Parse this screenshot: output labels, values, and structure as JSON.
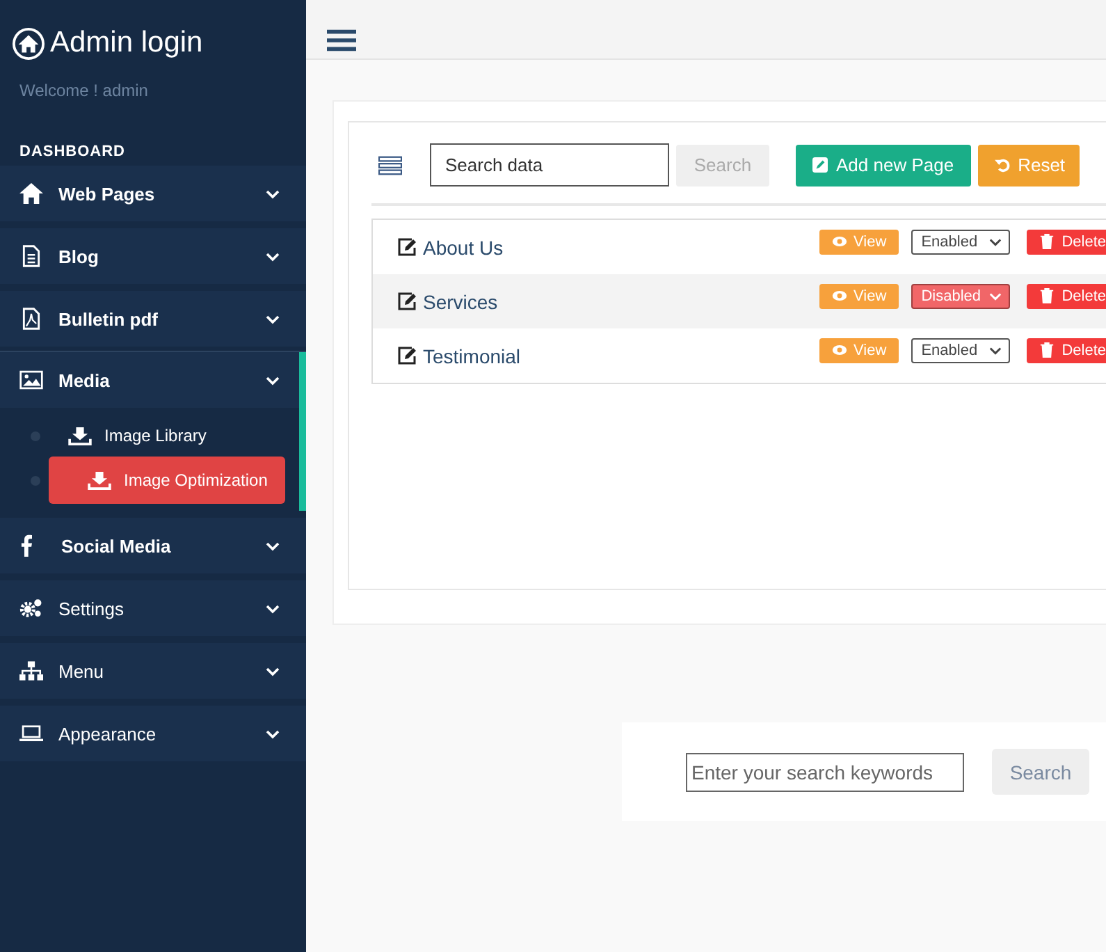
{
  "sidebar": {
    "title": "Admin login",
    "welcome": "Welcome ! admin",
    "section": "DASHBOARD",
    "items": [
      {
        "label": "Web Pages",
        "active": false
      },
      {
        "label": "Blog",
        "active": false
      },
      {
        "label": "Bulletin pdf",
        "active": false
      },
      {
        "label": "Media",
        "active": true,
        "children": [
          {
            "label": "Image Library",
            "selected": false
          },
          {
            "label": "Image Optimization",
            "selected": true
          }
        ]
      },
      {
        "label": "Social Media",
        "active": false
      },
      {
        "label": "Settings",
        "active": false
      },
      {
        "label": "Menu",
        "active": false
      },
      {
        "label": "Appearance",
        "active": false
      }
    ]
  },
  "toolbar": {
    "search_placeholder": "Search data",
    "search_button": "Search",
    "add_button": "Add new Page",
    "reset_button": "Reset"
  },
  "pages": [
    {
      "title": "About Us",
      "view": "View",
      "status": "Enabled",
      "enabled": true,
      "delete": "Delete",
      "highlighted": false
    },
    {
      "title": "Services",
      "view": "View",
      "status": "Disabled",
      "enabled": false,
      "delete": "Delete",
      "highlighted": true
    },
    {
      "title": "Testimonial",
      "view": "View",
      "status": "Enabled",
      "enabled": true,
      "delete": "Delete",
      "highlighted": false
    }
  ],
  "footer_search": {
    "placeholder": "Enter your search keywords",
    "button": "Search"
  }
}
